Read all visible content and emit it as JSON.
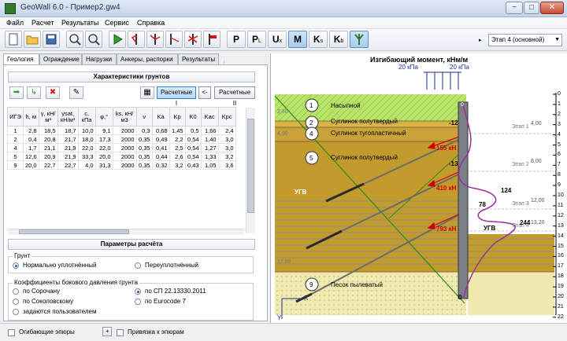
{
  "window": {
    "title": "GeoWall 6.0 - Пример2.gw4",
    "min_label": "−",
    "max_label": "□",
    "close_label": "✕"
  },
  "menu": [
    "Файл",
    "Расчет",
    "Результаты",
    "Сервис",
    "Справка"
  ],
  "toolbar": {
    "letter_buttons": [
      {
        "main": "P",
        "sub": ""
      },
      {
        "main": "P",
        "sub": "L"
      },
      {
        "main": "U",
        "sub": "x"
      },
      {
        "main": "M",
        "sub": ""
      },
      {
        "main": "K",
        "sub": "s"
      },
      {
        "main": "K",
        "sub": "b"
      }
    ],
    "stage_value": "Этап 4 (основной)"
  },
  "tabs": [
    "Геология",
    "Ограждение",
    "Нагрузки",
    "Анкеры, распорки",
    "Результаты"
  ],
  "soils": {
    "header": "Характеристики грунтов",
    "calc1_label": "Расчетные I",
    "arrow_label": "<-",
    "calc2_label": "Расчетные II",
    "columns": [
      "ИГЭ",
      "h, м",
      "γ, кН/м³",
      "γsat, кН/м³",
      "c, кПа",
      "φ,°",
      "ks, кН/м3",
      "ν",
      "Ka",
      "Kp",
      "K0",
      "Kac",
      "Kpc"
    ],
    "rows": [
      [
        "1",
        "2,8",
        "18,5",
        "18,7",
        "10,0",
        "9,1",
        "2000",
        "0,3",
        "0,68",
        "1,45",
        "0,5",
        "1,66",
        "2,4"
      ],
      [
        "2",
        "0,4",
        "20,8",
        "21,7",
        "18,0",
        "17,3",
        "2000",
        "0,35",
        "0,49",
        "2,2",
        "0,54",
        "1,40",
        "3,0"
      ],
      [
        "4",
        "1,7",
        "21,1",
        "21,9",
        "22,0",
        "22,0",
        "2000",
        "0,35",
        "0,41",
        "2,5",
        "0,54",
        "1,27",
        "3,0"
      ],
      [
        "5",
        "12,6",
        "20,9",
        "21,9",
        "33,3",
        "20,0",
        "2000",
        "0,35",
        "0,44",
        "2,6",
        "0,54",
        "1,33",
        "3,2"
      ],
      [
        "9",
        "20,0",
        "22,7",
        "22,7",
        "4,0",
        "31,3",
        "2000",
        "0,35",
        "0,32",
        "3,2",
        "0,43",
        "1,05",
        "3,6"
      ]
    ]
  },
  "calc_params": {
    "header": "Параметры расчёта",
    "ground_group": "Грунт",
    "normal_label": "Нормально уплотнённый",
    "over_label": "Переуплотнённый",
    "coef_group": "Коэффициенты бокового давления грунта",
    "opt_sorochan": "по Сорочану",
    "opt_sp": "по СП 22.13330.2011",
    "opt_sokolovsky": "по Соколовскому",
    "opt_eurocode": "по Eurocode 7",
    "opt_user": "задаются пользователем"
  },
  "bottom": {
    "envelopes_label": "Огибающие эпюры",
    "plus_label": "+",
    "bind_label": "Привязка к эпюрам"
  },
  "diagram": {
    "moment_title": "Изгибающий момент, кНм/м",
    "load_left": "20 кПа",
    "load_right": "20 кПа",
    "layers": [
      {
        "num": "1",
        "name": "Насыпной"
      },
      {
        "num": "2",
        "name": "Суглинок полутвердый"
      },
      {
        "num": "4",
        "name": "Суглинок тугопластичный"
      },
      {
        "num": "5",
        "name": "Суглинок полутвердый"
      },
      {
        "num": "9",
        "name": "Песок пылеватый"
      }
    ],
    "layer_depths": [
      "2,80",
      "4,90",
      "17,80"
    ],
    "stages": [
      {
        "label": "Этап 1",
        "depth": "4,00"
      },
      {
        "label": "Этап 2",
        "depth": "8,00"
      },
      {
        "label": "Этап 3",
        "depth": "12,00"
      },
      {
        "label": "Этап 4",
        "depth": "13,20"
      }
    ],
    "gwl_left": "УГВ",
    "gwl_right": "УГВ",
    "anchor_forces": [
      "155 кН",
      "410 кН",
      "793 кН"
    ],
    "moment_values": [
      "-12",
      "-13",
      "124",
      "78",
      "244",
      "0"
    ],
    "wall_marks": [
      "0"
    ],
    "axis_x": "X",
    "axis_y": "Y",
    "ruler": [
      "0",
      "1",
      "2",
      "3",
      "4",
      "5",
      "6",
      "7",
      "8",
      "9",
      "10",
      "11",
      "12",
      "13",
      "14",
      "15",
      "16",
      "17",
      "18",
      "19",
      "20",
      "21",
      "22"
    ]
  }
}
